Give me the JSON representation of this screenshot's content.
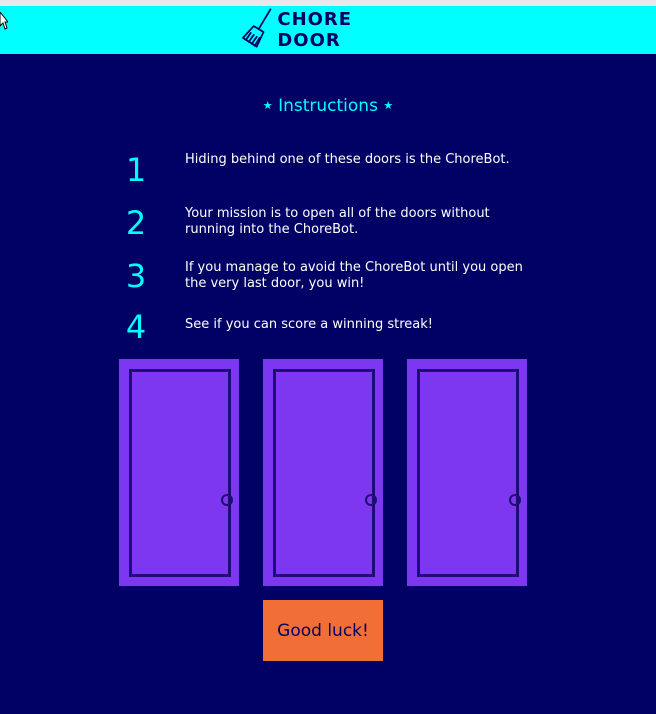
{
  "header": {
    "brand": "CHORE DOOR",
    "logo_icon": "broom-icon",
    "bg_color": "#00ffff"
  },
  "instructions": {
    "title": "Instructions",
    "star_glyph": "★",
    "steps": [
      {
        "number": "1",
        "text": "Hiding behind one of these doors is the ChoreBot."
      },
      {
        "number": "2",
        "text": "Your mission is to open all of the doors without running into the ChoreBot."
      },
      {
        "number": "3",
        "text": "If you manage to avoid the ChoreBot until you open the very last door, you win!"
      },
      {
        "number": "4",
        "text": "See if you can score a winning streak!"
      }
    ]
  },
  "doors": [
    {
      "icon": "closed-door-icon"
    },
    {
      "icon": "closed-door-icon"
    },
    {
      "icon": "closed-door-icon"
    }
  ],
  "start_button": {
    "label": "Good luck!"
  },
  "colors": {
    "page_bg": "#010165",
    "accent": "#00ffff",
    "door": "#7e37f0",
    "door_outline": "#1c0d7a",
    "button": "#f16e36"
  }
}
